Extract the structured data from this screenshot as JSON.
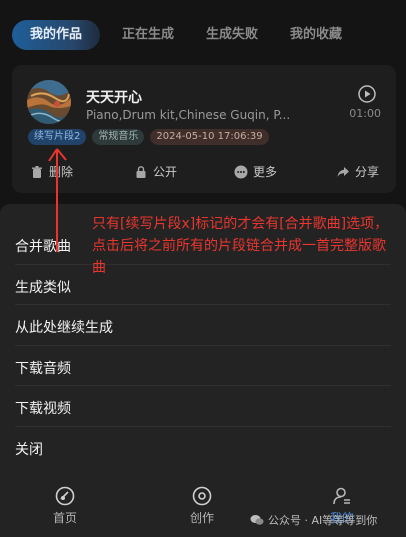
{
  "tabs": [
    "我的作品",
    "正在生成",
    "生成失败",
    "我的收藏"
  ],
  "song": {
    "title": "天天开心",
    "description": "Piano,Drum kit,Chinese Guqin, P...",
    "duration": "01:00",
    "tags": [
      "续写片段2",
      "常规音乐",
      "2024-05-10 17:06:39"
    ]
  },
  "actions": [
    "删除",
    "公开",
    "更多",
    "分享"
  ],
  "menu": [
    "合并歌曲",
    "生成类似",
    "从此处继续生成",
    "下载音频",
    "下载视频",
    "关闭"
  ],
  "annotation": "只有[续写片段x]标记的才会有[合并歌曲]选项，点击后将之前所有的片段链合并成一首完整版歌曲",
  "nav": [
    "首页",
    "创作",
    "我的"
  ],
  "watermark": "公众号 · AI等等等到你",
  "colors": {
    "accent": "#1f5f9a",
    "annotation": "#e8362f",
    "card": "#1e1e1e",
    "sheet": "#232323"
  }
}
